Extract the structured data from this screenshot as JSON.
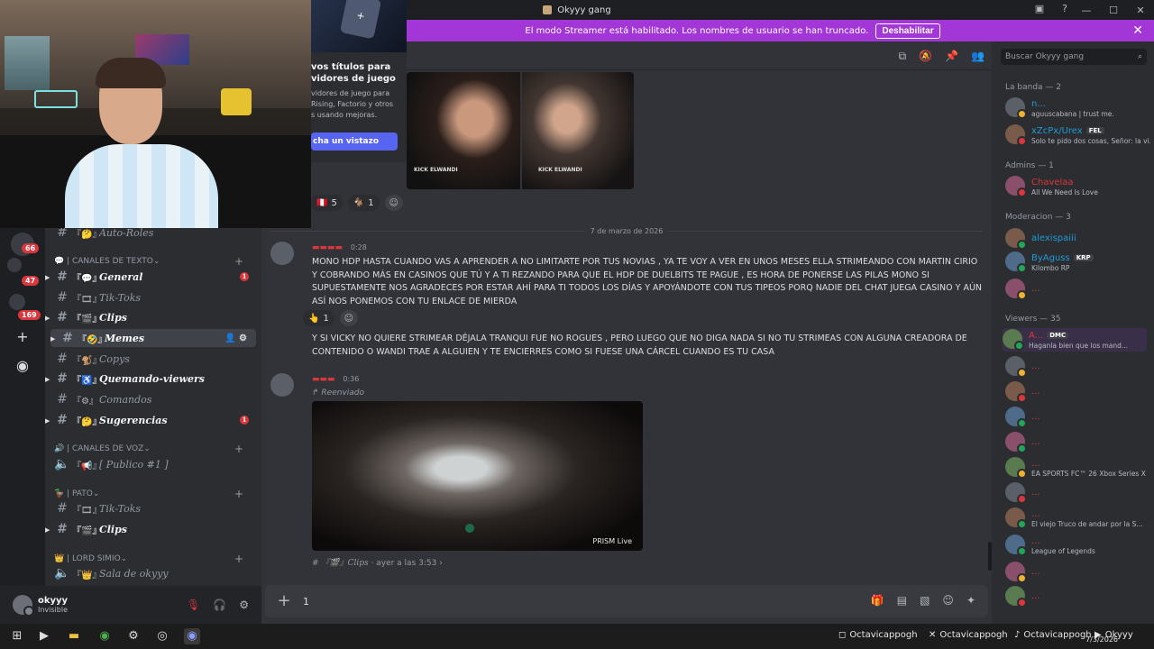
{
  "window": {
    "title": "Okyyy gang",
    "controls": [
      "—",
      "☐",
      "✕"
    ]
  },
  "banner": {
    "text": "El modo Streamer está habilitado. Los nombres de usuario se han truncado.",
    "button": "Deshabilitar"
  },
  "promo": {
    "title": "vos títulos para\nvidores de juego",
    "desc": "vidores de juego para\n Rising, Factorio y otros\ns usando mejoras.",
    "button": "cha un vistazo"
  },
  "rail": {
    "badges": [
      "66",
      "47",
      "169"
    ]
  },
  "channels": {
    "items": [
      {
        "kind": "channel",
        "emoji": "『🤔』",
        "label": "Auto-Roles",
        "unread": false
      },
      {
        "kind": "category",
        "label": "💬 | CANALES DE TEXTO"
      },
      {
        "kind": "channel",
        "emoji": "『💬』",
        "label": "General",
        "unread": true,
        "badge": "1"
      },
      {
        "kind": "channel",
        "emoji": "『🎞』",
        "label": "Tik-Toks",
        "unread": false
      },
      {
        "kind": "channel",
        "emoji": "『🎬』",
        "label": "Clips",
        "unread": true
      },
      {
        "kind": "channel",
        "emoji": "『🤣』",
        "label": "Memes",
        "unread": true,
        "active": true
      },
      {
        "kind": "channel",
        "emoji": "『🐒』",
        "label": "Copys",
        "unread": false
      },
      {
        "kind": "channel",
        "emoji": "『♿』",
        "label": "Quemando-viewers",
        "unread": true
      },
      {
        "kind": "channel",
        "emoji": "『⚙』",
        "label": "Comandos",
        "unread": false
      },
      {
        "kind": "channel",
        "emoji": "『🤔』",
        "label": "Sugerencias",
        "unread": true,
        "badge": "1"
      },
      {
        "kind": "category",
        "label": "🔊 | CANALES DE VOZ"
      },
      {
        "kind": "voice",
        "emoji": "『📢』",
        "label": "[ Publico #1 ]"
      },
      {
        "kind": "category",
        "label": "🦆 | PATO"
      },
      {
        "kind": "channel",
        "emoji": "『🎞』",
        "label": "Tik-Toks",
        "unread": false
      },
      {
        "kind": "channel",
        "emoji": "『🎬』",
        "label": "Clips",
        "unread": true
      },
      {
        "kind": "category",
        "label": "👑 | LORD SIMIO"
      },
      {
        "kind": "voice",
        "emoji": "『👑』",
        "label": "Sala de okyyy"
      }
    ]
  },
  "user": {
    "name": "okyyy",
    "status": "Invisible"
  },
  "chat": {
    "reactions_top": [
      {
        "emoji": "🇵🇪",
        "count": "5"
      },
      {
        "emoji": "🐐",
        "count": "1"
      }
    ],
    "photo_watermark": "KICK ELWANDI",
    "date_divider": "7 de marzo de 2026",
    "msg1": {
      "time": "0:28",
      "text1": "MONO HDP HASTA CUANDO VAS A APRENDER A NO LIMITARTE POR TUS NOVIAS , YA TE VOY A VER EN UNOS MESES ELLA STRIMEANDO CON MARTIN CIRIO Y COBRANDO MÁS EN CASINOS QUE TÚ Y A TI REZANDO  PARA QUE EL HDP DE DUELBITS TE PAGUE , ES HORA DE PONERSE LAS PILAS MONO SI SUPUESTAMENTE NOS AGRADECES POR ESTAR AHÍ PARA TI TODOS LOS DÍAS Y APOYÁNDOTE CON TUS TIPEOS PORQ NADIE DEL CHAT JUEGA CASINO Y AÚN ASÍ NOS PONEMOS CON TU ENLACE DE MIERDA",
      "reaction": {
        "emoji": "👆",
        "count": "1"
      },
      "text2": "Y SI VICKY NO QUIERE STRIMEAR DÉJALA TRANQUI FUE NO ROGUES , PERO LUEGO QUE NO DIGA NADA SI NO TU STRIMEAS CON ALGUNA CREADORA DE CONTENIDO O WANDI TRAE A ALGUIEN Y TE ENCIERRES COMO SI FUESE UNA CÁRCEL CUANDO ES TU CASA"
    },
    "msg2": {
      "time": "0:36",
      "forwarded": "Reenviado",
      "video_caption": "PRISM Live",
      "source_channel": "『🎬』Clips",
      "source_time": "ayer a las 3:53"
    },
    "composer_value": "1"
  },
  "members": {
    "search_placeholder": "Buscar Okyyy gang",
    "groups": [
      {
        "title": "La banda — 2",
        "people": [
          {
            "name": "n...",
            "sub": "aguuscabana | trust me.",
            "color": "#1e9bd7"
          },
          {
            "name": "xZcPx/Urex",
            "tag": "FEL",
            "sub": "Solo te pido dos cosas, Señor: la vi...",
            "color": "#1e9bd7"
          }
        ]
      },
      {
        "title": "Admins — 1",
        "people": [
          {
            "name": "Chavelaa",
            "sub": "All We Need Is Love",
            "color": "#da373c"
          }
        ]
      },
      {
        "title": "Moderacion — 3",
        "people": [
          {
            "name": "alexispaiii",
            "sub": "",
            "color": "#1e9bd7"
          },
          {
            "name": "ByAguss",
            "tag": "KRP",
            "sub": "Kilombo RP",
            "color": "#1e9bd7"
          },
          {
            "name": "... ",
            "sub": "",
            "color": "#da373c"
          }
        ]
      },
      {
        "title": "Viewers — 35",
        "people": [
          {
            "name": "A...",
            "tag": "DMC",
            "sub": "Haganla bien que los mand...",
            "color": "#da373c"
          },
          {
            "name": "...",
            "sub": "",
            "color": "#da373c"
          },
          {
            "name": "...",
            "sub": "",
            "color": "#da373c"
          },
          {
            "name": "...",
            "sub": "",
            "color": "#da373c"
          },
          {
            "name": "...",
            "sub": "",
            "color": "#da373c"
          },
          {
            "name": "...",
            "sub": "EA SPORTS FC™ 26 Xbox Series X",
            "color": "#da373c"
          },
          {
            "name": "...",
            "sub": "",
            "color": "#da373c"
          },
          {
            "name": "...",
            "sub": "El viejo Truco de andar por la S...",
            "color": "#da373c"
          },
          {
            "name": "...",
            "sub": "League of Legends",
            "color": "#da373c"
          },
          {
            "name": "...",
            "sub": "",
            "color": "#da373c"
          },
          {
            "name": "...",
            "sub": "",
            "color": "#da373c"
          }
        ]
      }
    ]
  },
  "taskbar": {
    "socials": [
      "Octavicappogh",
      "Octavicappogh",
      "Octavicappogh",
      "Okyyy"
    ],
    "time": "7/3/2026"
  }
}
